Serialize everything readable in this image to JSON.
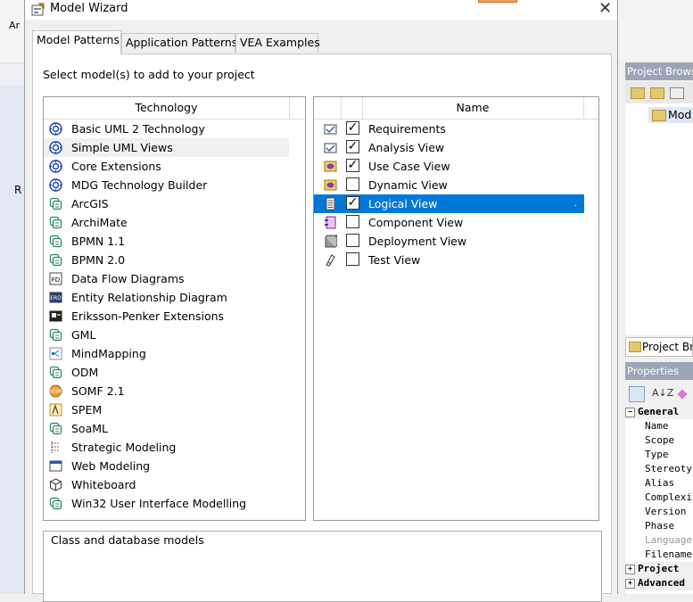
{
  "window": {
    "title": "Model Wizard",
    "close_glyph": "✕"
  },
  "tabs": [
    "Model Patterns",
    "Application Patterns",
    "VEA Examples"
  ],
  "instruction": "Select model(s) to add to your project",
  "technology_list": {
    "header": "Technology",
    "selected_index": 1,
    "items": [
      {
        "label": "Basic UML 2 Technology",
        "icon": "uml-gear-icon"
      },
      {
        "label": "Simple UML Views",
        "icon": "uml-gear-icon"
      },
      {
        "label": "Core Extensions",
        "icon": "uml-gear-icon"
      },
      {
        "label": "MDG Technology Builder",
        "icon": "uml-gear-icon"
      },
      {
        "label": "ArcGIS",
        "icon": "pattern-icon"
      },
      {
        "label": "ArchiMate",
        "icon": "pattern-icon"
      },
      {
        "label": "BPMN 1.1",
        "icon": "pattern-icon"
      },
      {
        "label": "BPMN 2.0",
        "icon": "pattern-icon"
      },
      {
        "label": "Data Flow Diagrams",
        "icon": "dfd-icon"
      },
      {
        "label": "Entity Relationship Diagram",
        "icon": "erd-icon"
      },
      {
        "label": "Eriksson-Penker Extensions",
        "icon": "ep-icon"
      },
      {
        "label": "GML",
        "icon": "pattern-icon"
      },
      {
        "label": "MindMapping",
        "icon": "mindmap-icon"
      },
      {
        "label": "ODM",
        "icon": "pattern-icon"
      },
      {
        "label": "SOMF 2.1",
        "icon": "somf-icon"
      },
      {
        "label": "SPEM",
        "icon": "spem-icon"
      },
      {
        "label": "SoaML",
        "icon": "pattern-icon"
      },
      {
        "label": "Strategic Modeling",
        "icon": "strategic-icon"
      },
      {
        "label": "Web Modeling",
        "icon": "web-icon"
      },
      {
        "label": "Whiteboard",
        "icon": "cube-icon"
      },
      {
        "label": "Win32 User Interface Modelling",
        "icon": "pattern-icon"
      }
    ]
  },
  "model_list": {
    "header": "Name",
    "selected_index": 4,
    "items": [
      {
        "label": "Requirements",
        "checked": true,
        "icon": "requirements-icon"
      },
      {
        "label": "Analysis View",
        "checked": true,
        "icon": "analysis-icon"
      },
      {
        "label": "Use Case View",
        "checked": true,
        "icon": "usecase-icon"
      },
      {
        "label": "Dynamic View",
        "checked": false,
        "icon": "dynamic-icon"
      },
      {
        "label": "Logical View",
        "checked": true,
        "icon": "logical-icon"
      },
      {
        "label": "Component View",
        "checked": false,
        "icon": "component-icon"
      },
      {
        "label": "Deployment View",
        "checked": false,
        "icon": "deployment-icon"
      },
      {
        "label": "Test View",
        "checked": false,
        "icon": "test-icon"
      }
    ],
    "check_glyph": "✓",
    "row_marker": "."
  },
  "description": "Class and database models",
  "background": {
    "left_menu_text": "Ar",
    "left_marker": "R",
    "project_browser_title": "Project Browse",
    "project_browser_node": "Mod",
    "project_browser_tab": "Project Bro",
    "properties_title": "Properties",
    "properties_sort_label": "A↓Z",
    "properties_rows": [
      {
        "label": "General",
        "type": "cat",
        "toggle": "−"
      },
      {
        "label": "Name",
        "type": "item"
      },
      {
        "label": "Scope",
        "type": "item"
      },
      {
        "label": "Type",
        "type": "item"
      },
      {
        "label": "Stereotype",
        "type": "item"
      },
      {
        "label": "Alias",
        "type": "item"
      },
      {
        "label": "Complexity",
        "type": "item"
      },
      {
        "label": "Version",
        "type": "item"
      },
      {
        "label": "Phase",
        "type": "item"
      },
      {
        "label": "Language",
        "type": "item",
        "dim": true
      },
      {
        "label": "Filename",
        "type": "item"
      },
      {
        "label": "Project",
        "type": "cat",
        "toggle": "+"
      },
      {
        "label": "Advanced",
        "type": "cat",
        "toggle": "+"
      }
    ]
  },
  "colors": {
    "selection": "#0078d7",
    "panel_title": "#9aa5b5"
  }
}
